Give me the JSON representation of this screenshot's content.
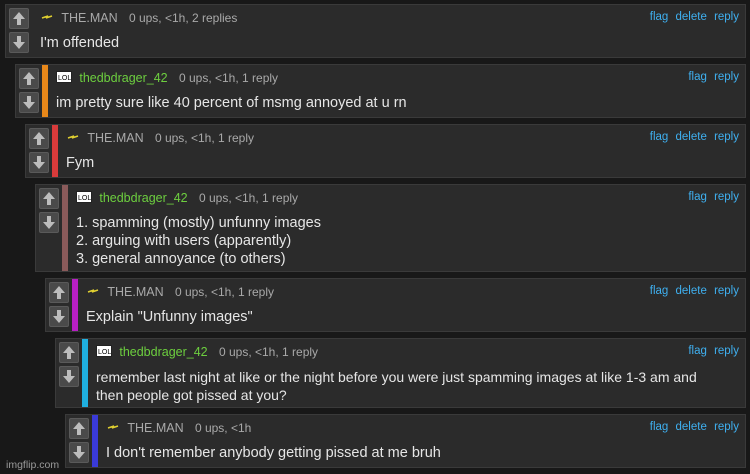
{
  "colors": {
    "bg": "#181818",
    "card": "#2b2b2b",
    "link": "#3fb0f0",
    "green_user": "#6dcf3f",
    "gray_user": "#a9a9a9"
  },
  "actions": {
    "flag": "flag",
    "delete": "delete",
    "reply": "reply"
  },
  "comments": [
    {
      "user": "THE.MAN",
      "meta": "0 ups, <1h, 2 replies",
      "lines": [
        "I'm offended"
      ],
      "bar": "none",
      "badge": "bolt-icon",
      "can_delete": true
    },
    {
      "user": "thedbdrager_42",
      "meta": "0 ups, <1h, 1 reply",
      "lines": [
        "im pretty sure like 40 percent of msmg annoyed at u rn"
      ],
      "bar": "#e8881a",
      "badge": "lol-icon",
      "can_delete": false
    },
    {
      "user": "THE.MAN",
      "meta": "0 ups, <1h, 1 reply",
      "lines": [
        "Fym"
      ],
      "bar": "#d93b3b",
      "badge": "bolt-icon",
      "can_delete": true
    },
    {
      "user": "thedbdrager_42",
      "meta": "0 ups, <1h, 1 reply",
      "lines": [
        "1. spamming (mostly) unfunny images",
        "2. arguing with users (apparently)",
        "3. general annoyance (to others)"
      ],
      "bar": "#8a5a5a",
      "badge": "lol-icon",
      "can_delete": false
    },
    {
      "user": "THE.MAN",
      "meta": "0 ups, <1h, 1 reply",
      "lines": [
        "Explain \"Unfunny images\""
      ],
      "bar": "#b81fc4",
      "badge": "bolt-icon",
      "can_delete": true
    },
    {
      "user": "thedbdrager_42",
      "meta": "0 ups, <1h, 1 reply",
      "lines": [
        "remember last night at like or the night before you were just spamming images at like 1-3 am and",
        "then people got pissed at you?"
      ],
      "bar": "#1fb0e0",
      "badge": "lol-icon",
      "can_delete": false
    },
    {
      "user": "THE.MAN",
      "meta": "0 ups, <1h",
      "lines": [
        "I don't remember anybody getting pissed at me bruh"
      ],
      "bar": "#3a3ad8",
      "badge": "bolt-icon",
      "can_delete": true
    }
  ],
  "watermark": "imgflip.com"
}
